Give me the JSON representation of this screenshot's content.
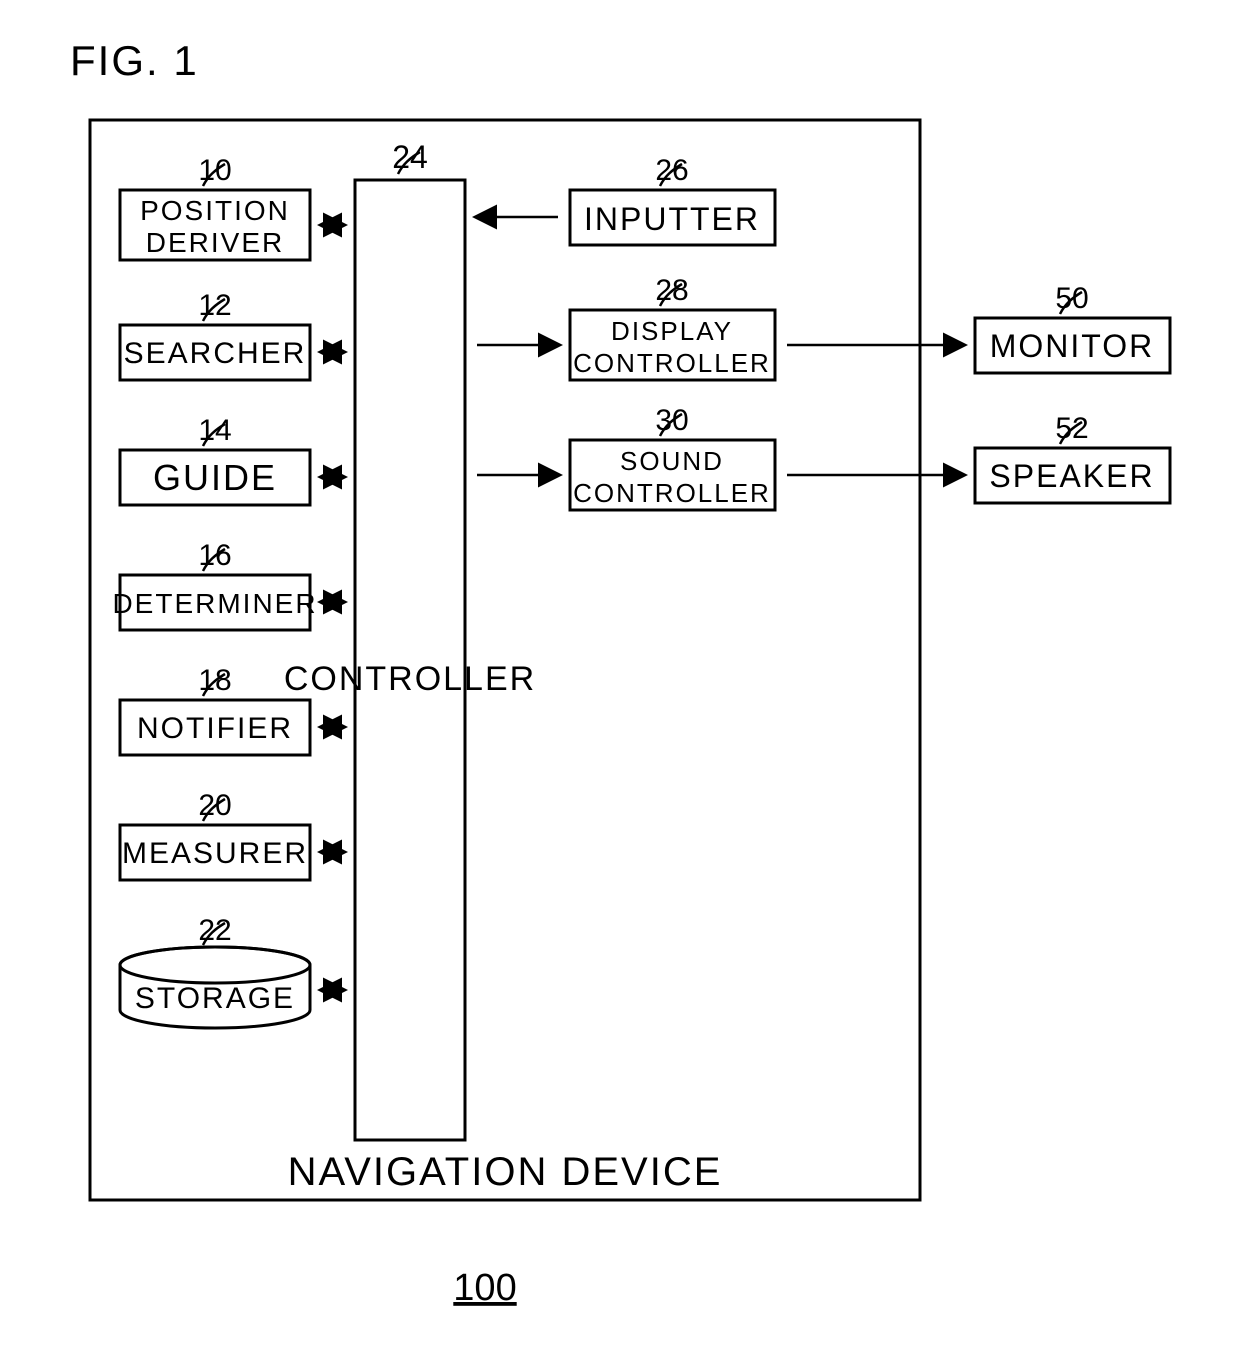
{
  "figure_label": "FIG. 1",
  "device": {
    "ref": "100",
    "label": "NAVIGATION DEVICE"
  },
  "blocks": {
    "position_deriver": {
      "ref": "10",
      "line1": "POSITION",
      "line2": "DERIVER"
    },
    "searcher": {
      "ref": "12",
      "label": "SEARCHER"
    },
    "guide": {
      "ref": "14",
      "label": "GUIDE"
    },
    "determiner": {
      "ref": "16",
      "label": "DETERMINER"
    },
    "notifier": {
      "ref": "18",
      "label": "NOTIFIER"
    },
    "measurer": {
      "ref": "20",
      "label": "MEASURER"
    },
    "storage": {
      "ref": "22",
      "label": "STORAGE"
    },
    "controller": {
      "ref": "24",
      "label": "CONTROLLER"
    },
    "inputter": {
      "ref": "26",
      "label": "INPUTTER"
    },
    "display_ctrl": {
      "ref": "28",
      "line1": "DISPLAY",
      "line2": "CONTROLLER"
    },
    "sound_ctrl": {
      "ref": "30",
      "line1": "SOUND",
      "line2": "CONTROLLER"
    },
    "monitor": {
      "ref": "50",
      "label": "MONITOR"
    },
    "speaker": {
      "ref": "52",
      "label": "SPEAKER"
    }
  }
}
